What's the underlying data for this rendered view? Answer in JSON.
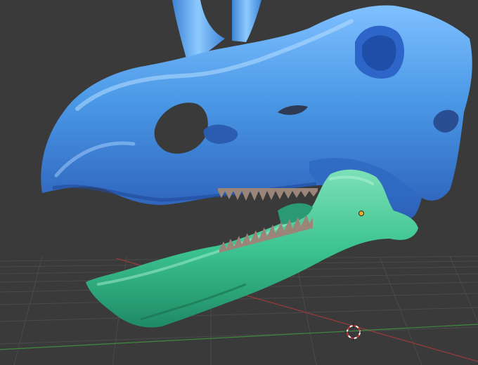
{
  "viewport": {
    "background": "#3a3a3a",
    "grid_color": "#4a4a4a",
    "x_axis_color": "#9a3a3a",
    "y_axis_color": "#3f8a3f"
  },
  "scene": {
    "skull_color": "#4a98e6",
    "skull_shadow_color": "#2c5fb8",
    "skull_highlight_color": "#9dd0ff",
    "jaw_color": "#3cc491",
    "jaw_shadow_color": "#1f8a66",
    "jaw_highlight_color": "#8ee7c4",
    "teeth_color": "#9a8578",
    "origin_color": "#e7a92a",
    "cursor_color": "#cc3333"
  }
}
